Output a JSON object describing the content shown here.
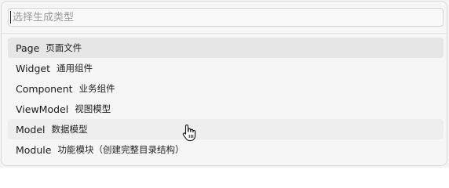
{
  "search": {
    "placeholder": "选择生成类型",
    "value": ""
  },
  "items": [
    {
      "label": "Page",
      "desc": "页面文件",
      "state": "selected"
    },
    {
      "label": "Widget",
      "desc": "通用组件",
      "state": ""
    },
    {
      "label": "Component",
      "desc": "业务组件",
      "state": ""
    },
    {
      "label": "ViewModel",
      "desc": "视图模型",
      "state": ""
    },
    {
      "label": "Model",
      "desc": "数据模型",
      "state": "hover"
    },
    {
      "label": "Module",
      "desc": "功能模块（创建完整目录结构）",
      "state": ""
    }
  ],
  "cursor": {
    "icon": "hand-pointer-icon"
  }
}
